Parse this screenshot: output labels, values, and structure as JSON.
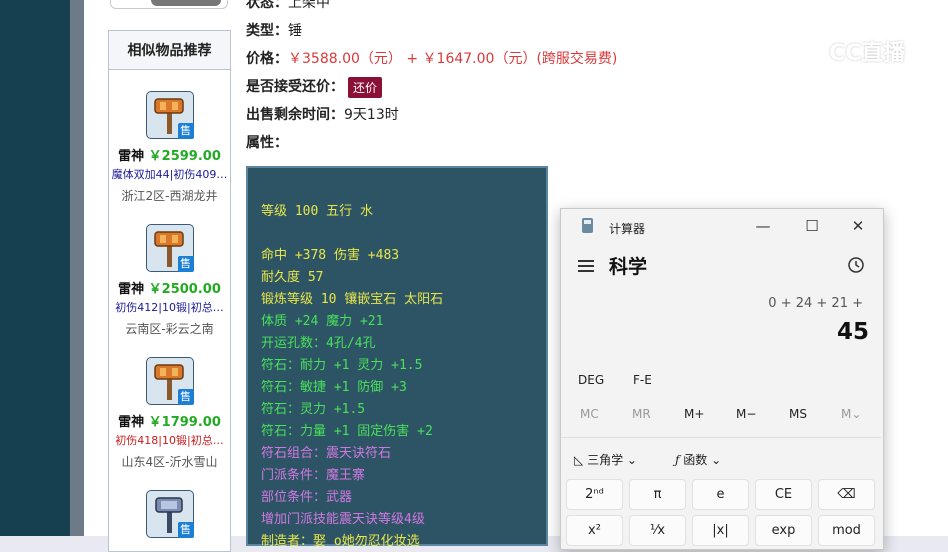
{
  "item": {
    "status_label": "状态：",
    "status_value": "上架中",
    "type_label": "类型：",
    "type_value": "锤",
    "price_label": "价格：",
    "price_main": "￥3588.00（元）",
    "price_plus": "+",
    "price_fee": "￥1647.00（元）(跨服交易费)",
    "counter_label": "是否接受还价：",
    "counter_button": "还价",
    "time_label": "出售剩余时间：",
    "time_value": "9天13时",
    "attr_label": "属性："
  },
  "attributes": [
    {
      "text": "等级 100 五行 水",
      "color": "yellow"
    },
    {
      "text": "命中 +378 伤害 +483",
      "color": "yellow"
    },
    {
      "text": "耐久度 57",
      "color": "yellow"
    },
    {
      "text": "锻炼等级 10 镶嵌宝石 太阳石",
      "color": "yellow"
    },
    {
      "text": "体质 +24 魔力 +21",
      "color": "green"
    },
    {
      "text": "开运孔数：4孔/4孔",
      "color": "green"
    },
    {
      "text": "符石：耐力 +1 灵力 +1.5",
      "color": "green"
    },
    {
      "text": "符石：敏捷 +1 防御 +3",
      "color": "green"
    },
    {
      "text": "符石：灵力 +1.5",
      "color": "green"
    },
    {
      "text": "符石：力量 +1 固定伤害 +2",
      "color": "green"
    },
    {
      "text": "符石组合：震天诀符石",
      "color": "purple"
    },
    {
      "text": "门派条件：魔王寨",
      "color": "purple"
    },
    {
      "text": "部位条件：武器",
      "color": "purple"
    },
    {
      "text": "增加门派技能震天诀等级4级",
      "color": "purple"
    },
    {
      "text": "制造者：娶 o她勿忍化妆选",
      "color": "yellow"
    }
  ],
  "sidebar": {
    "title": "相似物品推荐",
    "sell_badge": "售",
    "items": [
      {
        "name": "雷神",
        "price": "￥2599.00",
        "desc": "魔体双加44|初伤409…",
        "desc_color": "#1a1a9a",
        "server": "浙江2区-西湖龙井"
      },
      {
        "name": "雷神",
        "price": "￥2500.00",
        "desc": "初伤412|10锻|初总…",
        "desc_color": "#1a1a9a",
        "server": "云南区-彩云之南"
      },
      {
        "name": "雷神",
        "price": "￥1799.00",
        "desc": "初伤418|10锻|初总…",
        "desc_color": "#cc1a1a",
        "server": "山东4区-沂水雪山"
      }
    ]
  },
  "watermark": {
    "text": "CC直播"
  },
  "calculator": {
    "title": "计算器",
    "mode": "科学",
    "expression": "0 + 24 + 21 +",
    "result": "45",
    "deg": "DEG",
    "fe": "F-E",
    "memory": [
      "MC",
      "MR",
      "M+",
      "M−",
      "MS",
      "M⌄"
    ],
    "trig": "三角学",
    "func": "函数",
    "keys_row1": [
      "2ⁿᵈ",
      "π",
      "e",
      "CE",
      "⌫"
    ],
    "keys_row2": [
      "x²",
      "¹⁄x",
      "|x|",
      "exp",
      "mod"
    ],
    "win_min": "—",
    "win_max": "☐",
    "win_close": "✕"
  }
}
